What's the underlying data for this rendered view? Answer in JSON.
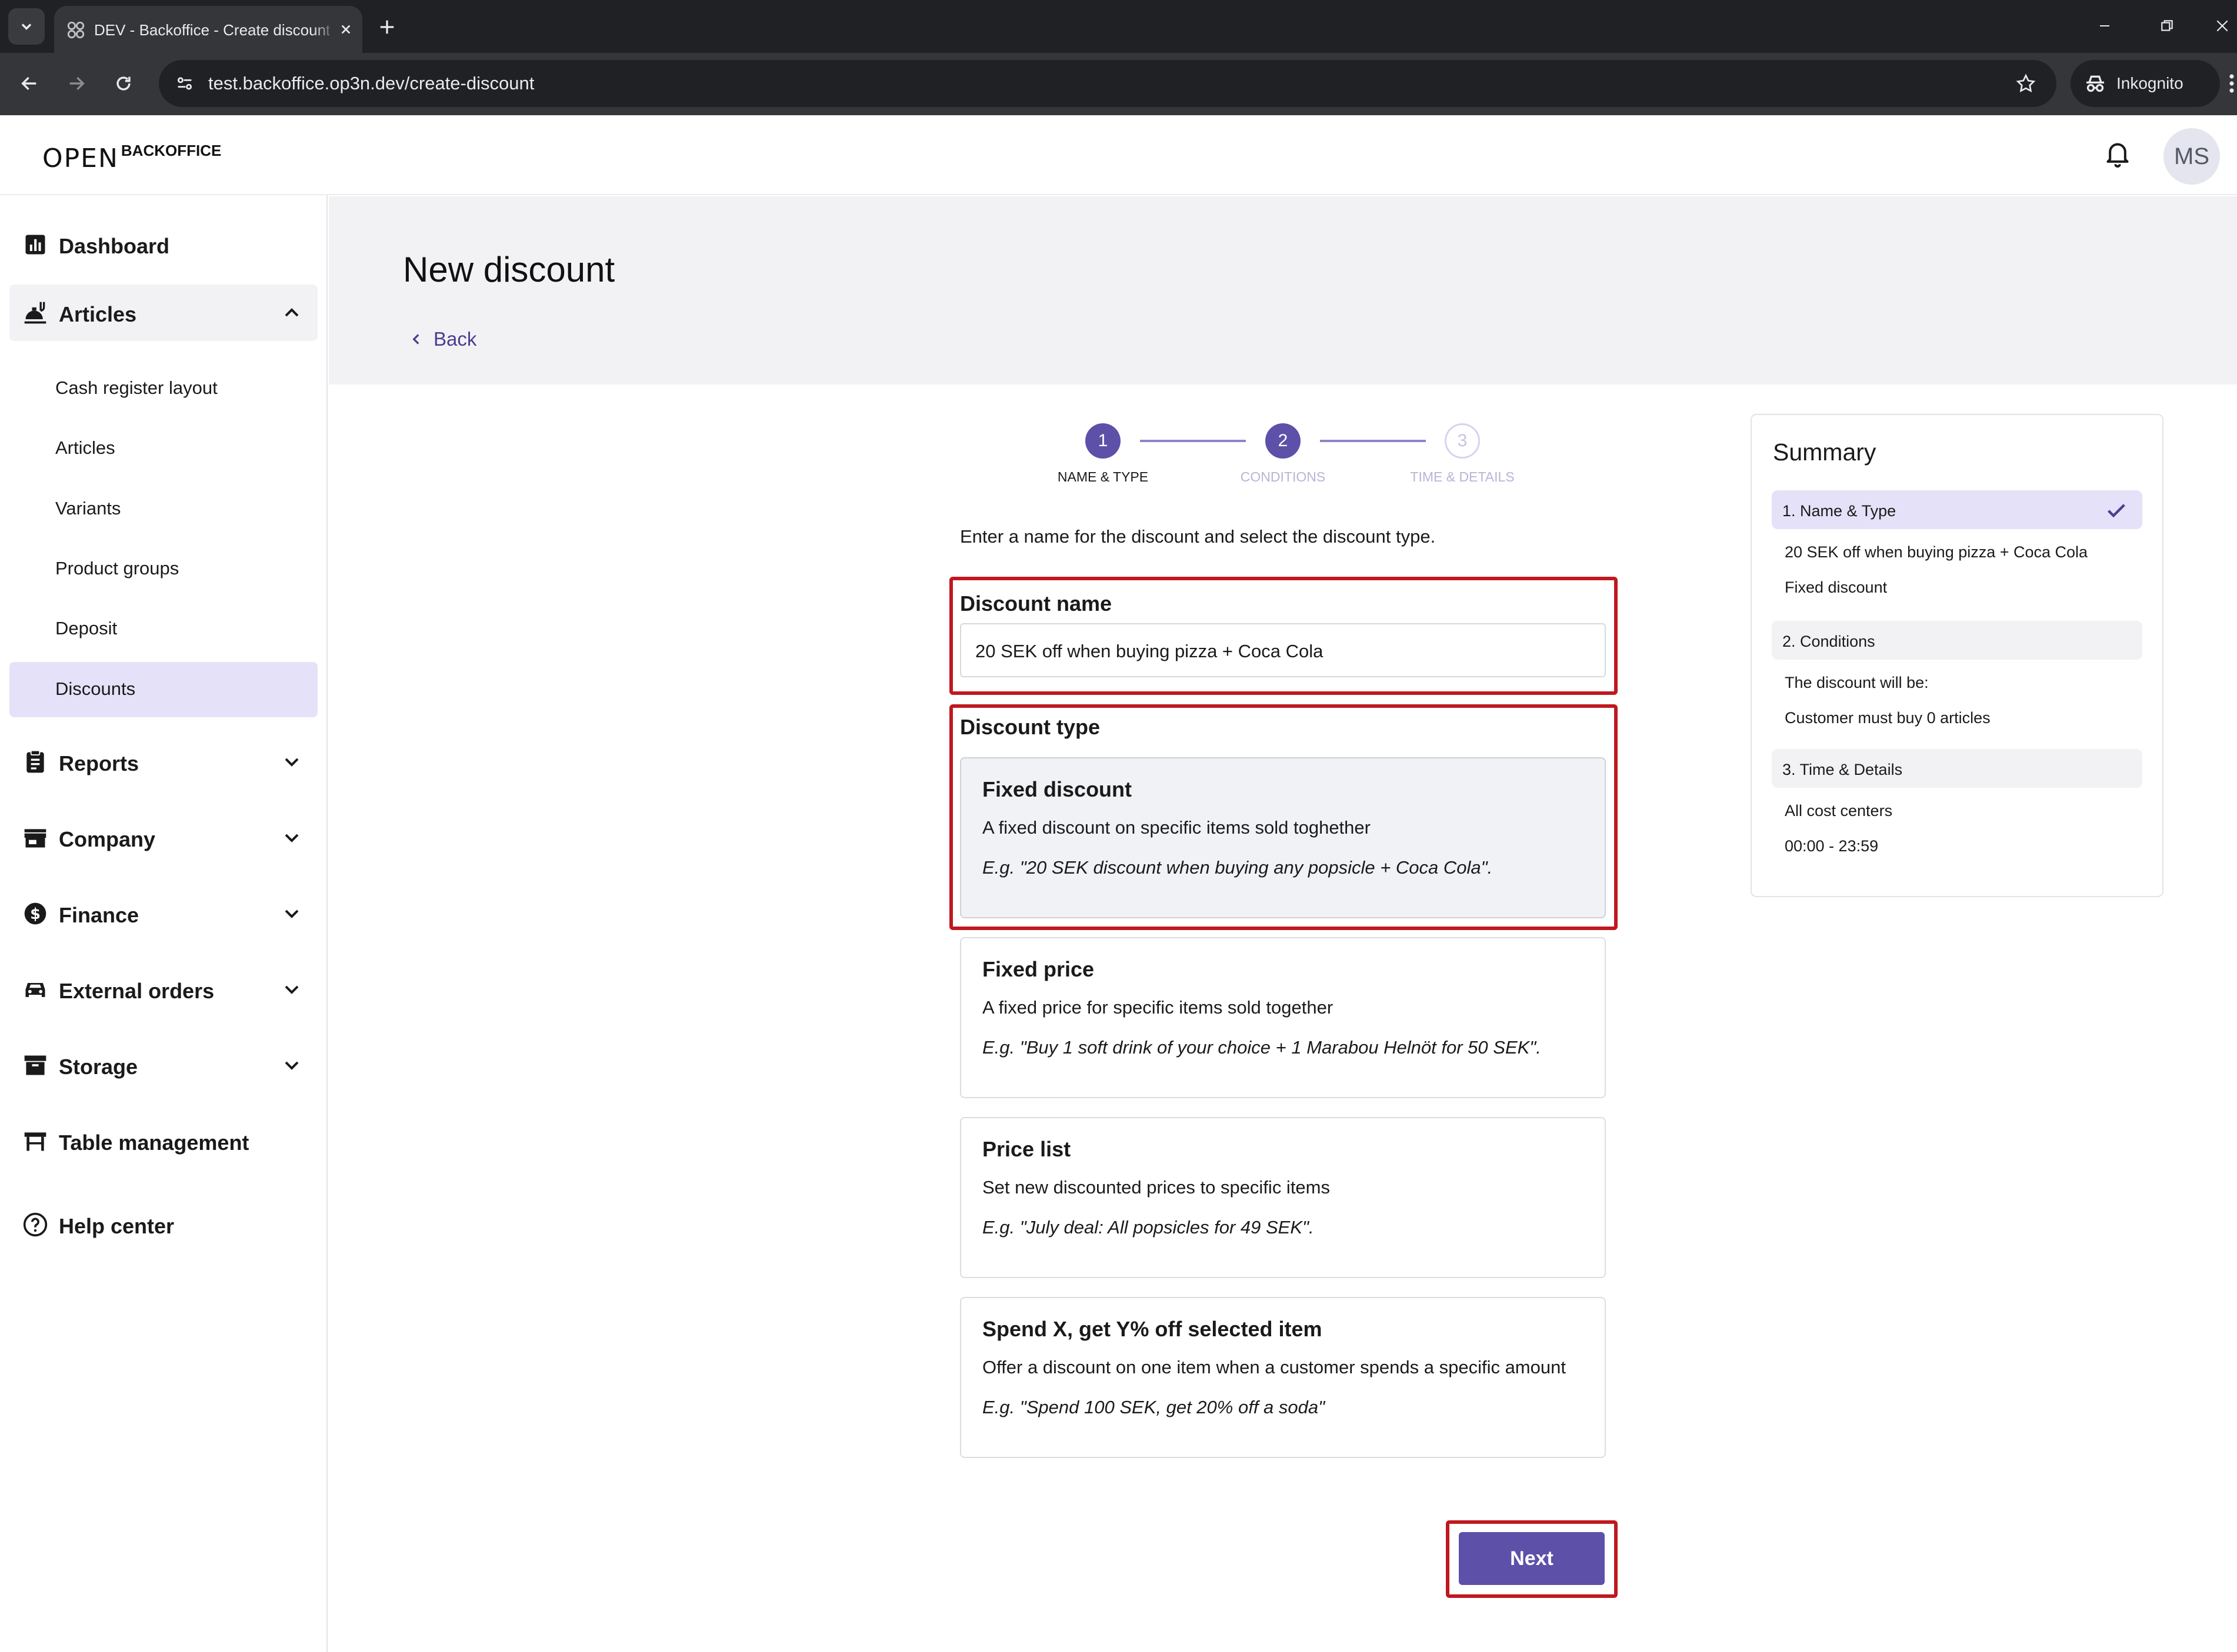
{
  "browser": {
    "tab_title": "DEV - Backoffice - Create discount",
    "url": "test.backoffice.op3n.dev/create-discount",
    "incognito_label": "Inkognito"
  },
  "header": {
    "logo_mark": "OPEN",
    "logo_text": "BACKOFFICE",
    "avatar_initials": "MS"
  },
  "sidebar": {
    "dashboard": "Dashboard",
    "articles": "Articles",
    "articles_sub": [
      "Cash register layout",
      "Articles",
      "Variants",
      "Product groups",
      "Deposit",
      "Discounts"
    ],
    "reports": "Reports",
    "company": "Company",
    "finance": "Finance",
    "external_orders": "External orders",
    "storage": "Storage",
    "table_management": "Table management",
    "help_center": "Help center"
  },
  "page": {
    "title": "New discount",
    "back_label": "Back"
  },
  "stepper": {
    "steps": [
      {
        "number": "1",
        "label": "NAME & TYPE"
      },
      {
        "number": "2",
        "label": "CONDITIONS"
      },
      {
        "number": "3",
        "label": "TIME & DETAILS"
      }
    ]
  },
  "form": {
    "intro": "Enter a name for the discount and select the discount type.",
    "name_label": "Discount name",
    "name_value": "20 SEK off when buying pizza + Coca Cola",
    "type_label": "Discount type",
    "types": [
      {
        "title": "Fixed discount",
        "description": "A fixed discount on specific items sold toghether",
        "example": "E.g. \"20 SEK discount when buying any popsicle + Coca Cola\"."
      },
      {
        "title": "Fixed price",
        "description": "A fixed price for specific items sold together",
        "example": "E.g. \"Buy 1 soft drink of your choice + 1 Marabou Helnöt for 50 SEK\"."
      },
      {
        "title": "Price list",
        "description": "Set new discounted prices to specific items",
        "example": "E.g. \"July deal: All popsicles for 49 SEK\"."
      },
      {
        "title": "Spend X, get Y% off selected item",
        "description": "Offer a discount on one item when a customer spends a specific amount",
        "example": "E.g. \"Spend 100 SEK, get 20% off a soda\""
      }
    ],
    "next_label": "Next"
  },
  "summary": {
    "title": "Summary",
    "sections": [
      {
        "label": "1. Name & Type",
        "lines": [
          "20 SEK off when buying pizza + Coca Cola",
          "Fixed discount"
        ]
      },
      {
        "label": "2. Conditions",
        "lines": [
          "The discount will be:",
          "Customer must buy 0 articles"
        ]
      },
      {
        "label": "3. Time & Details",
        "lines": [
          "All cost centers",
          "00:00 - 23:59"
        ]
      }
    ]
  },
  "colors": {
    "accent": "#5d50a8",
    "highlight_border": "#c0181f",
    "active_nav_bg": "#e5e1f8"
  },
  "icons": {
    "dashboard": "bar-chart-icon",
    "articles": "food-tray-icon",
    "reports": "clipboard-icon",
    "company": "storefront-icon",
    "finance": "dollar-circle-icon",
    "external_orders": "car-icon",
    "storage": "archive-box-icon",
    "table_management": "table-icon",
    "help_center": "help-circle-icon"
  }
}
